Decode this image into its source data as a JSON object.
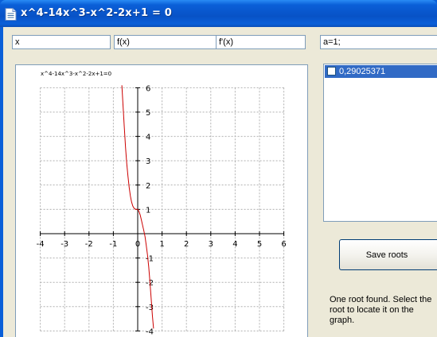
{
  "window": {
    "title": "x^4-14x^3-x^2-2x+1 = 0"
  },
  "inputs": {
    "x_label": "x",
    "fx_label": "f(x)",
    "dfx_label": "f'(x)",
    "params": "a=1;"
  },
  "roots_list": {
    "items": [
      {
        "label": "0,29025371",
        "checked": false,
        "selected": true
      }
    ]
  },
  "save_button": {
    "label": "Save roots"
  },
  "status": {
    "message": "One root found. Select the root to locate it on the graph."
  },
  "chart_data": {
    "type": "line",
    "title": "x^4-14x^3-x^2-2x+1=0",
    "xlim": [
      -4,
      6
    ],
    "ylim": [
      -4,
      6
    ],
    "x_ticks": [
      -4,
      -3,
      -2,
      -1,
      0,
      1,
      2,
      3,
      4,
      5,
      6
    ],
    "y_ticks": [
      -4,
      -3,
      -2,
      -1,
      1,
      2,
      3,
      4,
      5,
      6
    ],
    "grid": true,
    "series": [
      {
        "color": "#cc0000",
        "x": [
          -0.65,
          -0.6,
          -0.55,
          -0.5,
          -0.45,
          -0.4,
          -0.35,
          -0.3,
          -0.25,
          -0.2,
          -0.15,
          -0.1,
          -0.05,
          0,
          0.05,
          0.1,
          0.15,
          0.2,
          0.25,
          0.3,
          0.35,
          0.4,
          0.45,
          0.5,
          0.55,
          0.6,
          0.65
        ],
        "y": [
          6.1,
          5.25,
          4.35,
          3.55,
          2.9,
          2.35,
          1.9,
          1.55,
          1.3,
          1.13,
          1.05,
          1.01,
          1.0,
          1.0,
          0.92,
          0.77,
          0.57,
          0.35,
          0.12,
          -0.12,
          -0.47,
          -0.85,
          -1.35,
          -1.95,
          -2.62,
          -3.35,
          -3.9
        ]
      }
    ]
  }
}
